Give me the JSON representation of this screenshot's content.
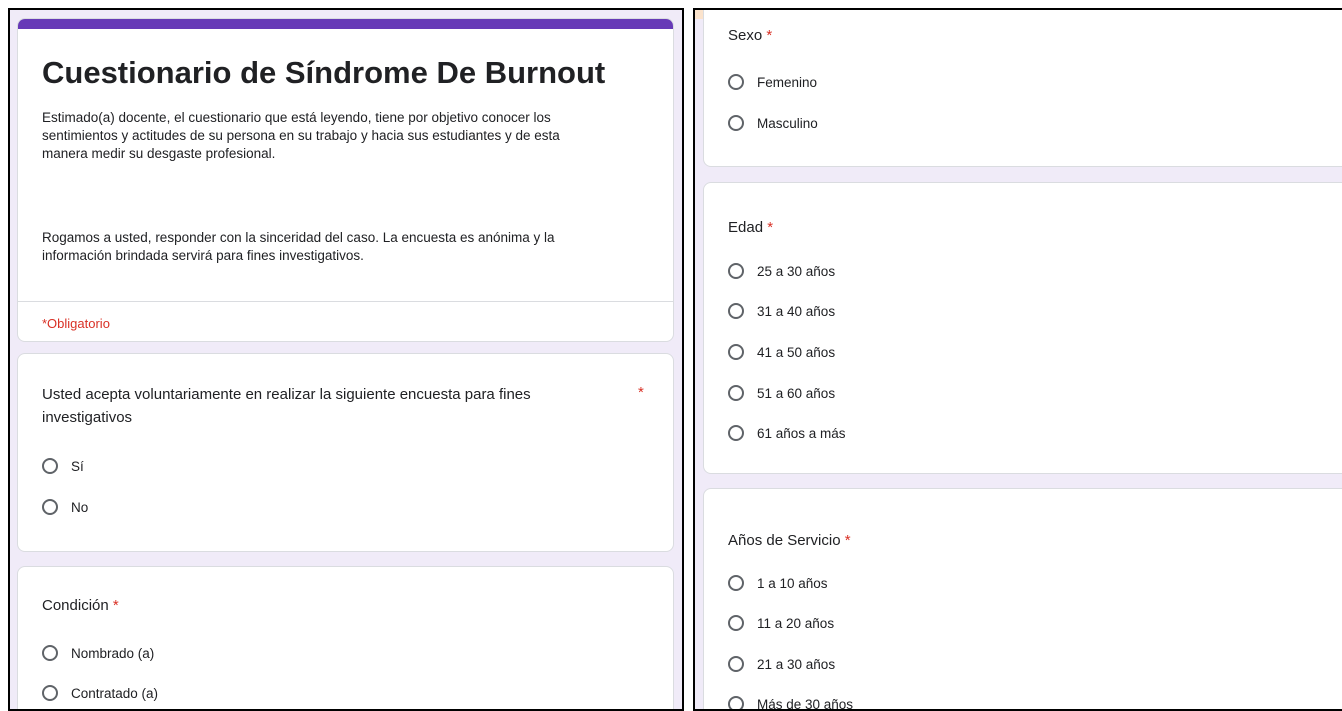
{
  "form": {
    "title": "Cuestionario de Síndrome De Burnout",
    "description_1": "Estimado(a) docente, el cuestionario que está leyendo, tiene por objetivo conocer los sentimientos y actitudes de su persona en su trabajo y hacia sus estudiantes y de esta manera medir su desgaste profesional.",
    "description_2": "Rogamos a usted, responder con la sinceridad del caso. La encuesta es anónima y la información brindada servirá para fines investigativos.",
    "required_note": "*Obligatorio",
    "accent_color": "#673ab7",
    "required_color": "#d93025",
    "background_color": "#f0ebf8"
  },
  "questions": {
    "consent": {
      "title": "Usted acepta voluntariamente en realizar la siguiente encuesta para fines investigativos",
      "required_mark": "*",
      "options": [
        "Sí",
        "No"
      ]
    },
    "condicion": {
      "title": "Condición",
      "required_mark": "*",
      "options": [
        "Nombrado (a)",
        "Contratado (a)"
      ]
    },
    "sexo": {
      "title": "Sexo",
      "required_mark": "*",
      "options": [
        "Femenino",
        "Masculino"
      ]
    },
    "edad": {
      "title": "Edad",
      "required_mark": "*",
      "options": [
        "25 a 30 años",
        "31 a 40 años",
        "41 a 50 años",
        "51 a 60 años",
        "61 años a más"
      ]
    },
    "servicio": {
      "title": "Años de Servicio",
      "required_mark": "*",
      "options": [
        "1 a 10 años",
        "11 a 20 años",
        "21 a 30 años",
        "Más de 30 años"
      ]
    }
  }
}
